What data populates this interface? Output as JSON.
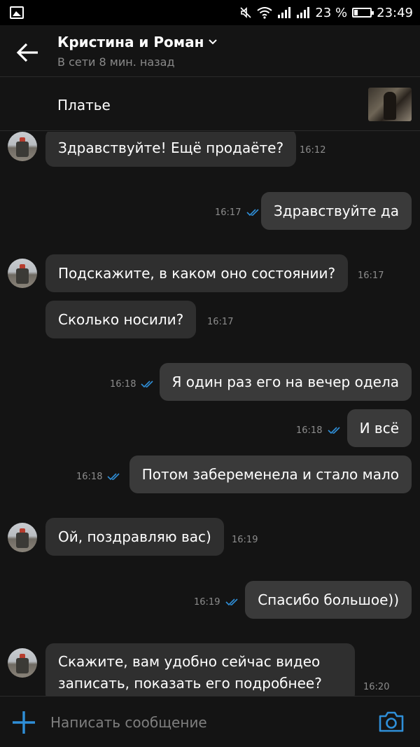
{
  "status_bar": {
    "battery": "23 %",
    "time": "23:49"
  },
  "header": {
    "title": "Кристина и Роман",
    "subtitle": "В сети 8 мин. назад"
  },
  "product": {
    "name": "Платье"
  },
  "messages": [
    {
      "text": "Здравствуйте! Ещё продаёте?",
      "time": "16:12",
      "direction": "in"
    },
    {
      "text": "Здравствуйте да",
      "time": "16:17",
      "direction": "out"
    },
    {
      "text": "Подскажите, в каком оно состоянии?",
      "time": "16:17",
      "direction": "in"
    },
    {
      "text": "Сколько носили?",
      "time": "16:17",
      "direction": "in"
    },
    {
      "text": "Я один раз его на вечер одела",
      "time": "16:18",
      "direction": "out"
    },
    {
      "text": "И всё",
      "time": "16:18",
      "direction": "out"
    },
    {
      "text": "Потом забеременела и стало мало",
      "time": "16:18",
      "direction": "out"
    },
    {
      "text": "Ой, поздравляю вас)",
      "time": "16:19",
      "direction": "in"
    },
    {
      "text": "Спасибо большое))",
      "time": "16:19",
      "direction": "out"
    },
    {
      "text": "Скажите, вам удобно сейчас видео записать, показать его подробнее?",
      "time": "16:20",
      "direction": "in"
    }
  ],
  "composer": {
    "placeholder": "Написать сообщение"
  },
  "colors": {
    "accent": "#2f8fd8",
    "background": "#141414",
    "bubble": "#2f2f2f"
  }
}
